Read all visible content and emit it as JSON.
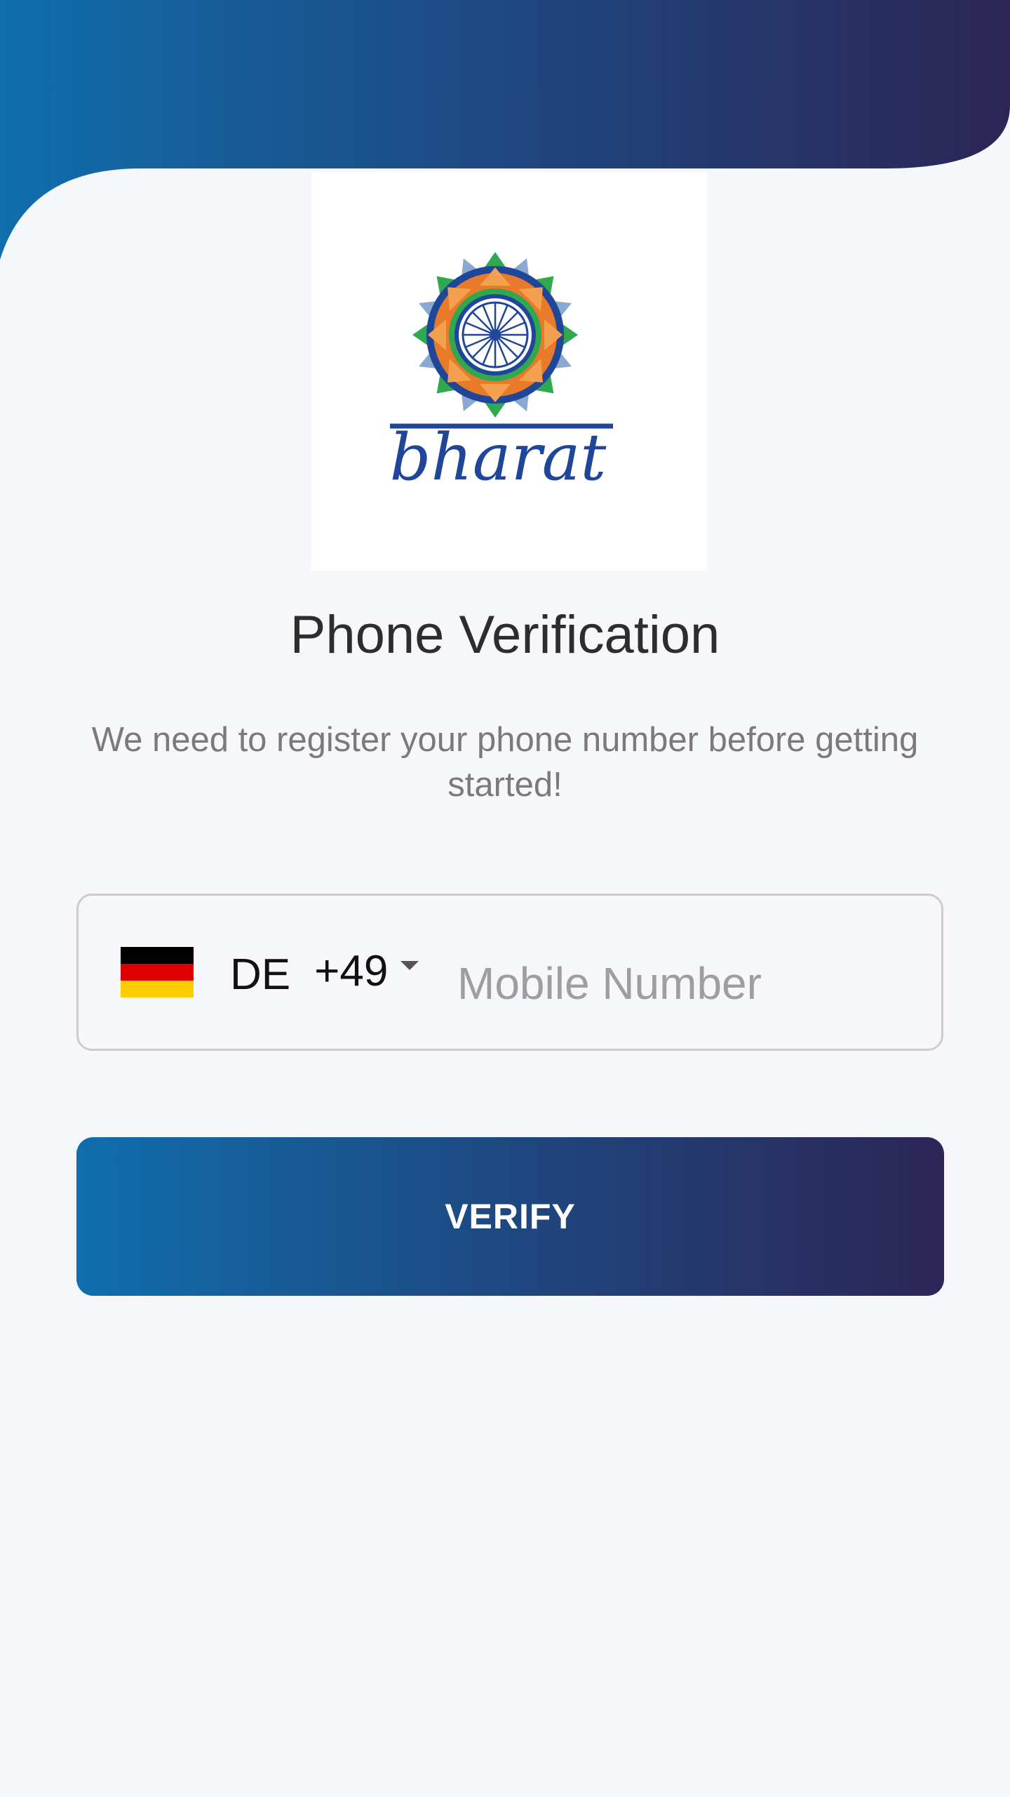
{
  "app": {
    "logo_text": "bharat"
  },
  "header": {
    "gradient_start": "#106EAD",
    "gradient_end": "#2C2556"
  },
  "main": {
    "title": "Phone Verification",
    "subtitle": "We need to register your phone number before getting started!"
  },
  "phone_input": {
    "country_iso": "DE",
    "dial_code": "+49",
    "flag_icon": "germany-flag-icon",
    "flag_colors": [
      "#000000",
      "#DD0000",
      "#FFCE00"
    ],
    "value": "",
    "placeholder": "Mobile Number"
  },
  "verify_button": {
    "label": "VERIFY"
  },
  "colors": {
    "background": "#F5F7FA",
    "logo_blue": "#20469A",
    "logo_orange": "#E97A2A",
    "logo_green": "#2FA84F"
  }
}
